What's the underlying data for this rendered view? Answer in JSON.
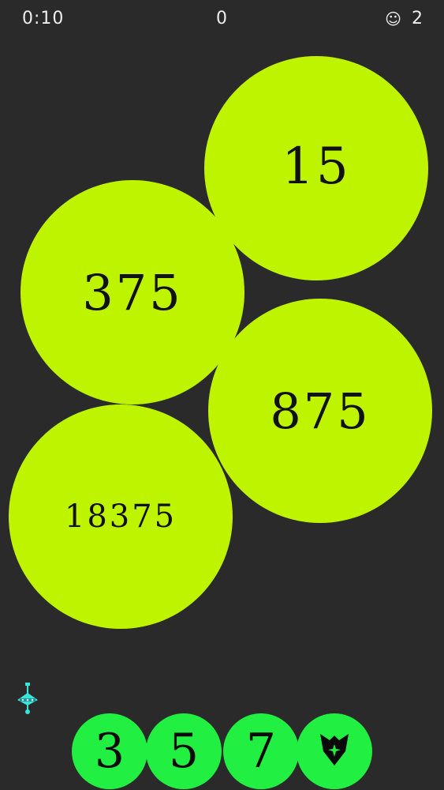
{
  "hud": {
    "timer": "0:10",
    "score": "0",
    "lives_icon": "smiley-icon",
    "lives": "2"
  },
  "colors": {
    "background": "#2a2a2a",
    "bubble": "#bff400",
    "tile": "#21ef42",
    "helper": "#36e6d6"
  },
  "bubbles": [
    {
      "label": "15"
    },
    {
      "label": "375"
    },
    {
      "label": "875"
    },
    {
      "label": "18375"
    }
  ],
  "tiles": [
    {
      "label": "3"
    },
    {
      "label": "5"
    },
    {
      "label": "7"
    },
    {
      "icon": "shield-star-icon"
    }
  ],
  "helper_icon": "spinning-top-icon"
}
